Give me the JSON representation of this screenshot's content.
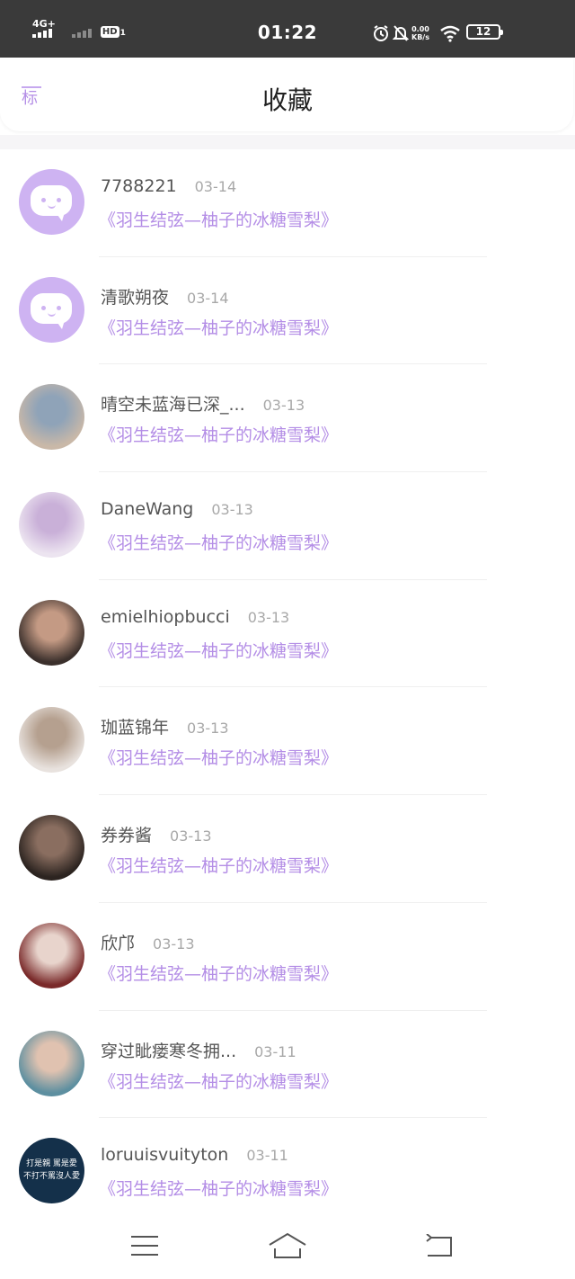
{
  "status_bar": {
    "network": "4G+",
    "hd_label": "HD",
    "hd_sub": "1",
    "time": "01:22",
    "speed_value": "0.00",
    "speed_unit": "KB/s",
    "battery": "12"
  },
  "header": {
    "back_label": "标",
    "title": "收藏"
  },
  "favorites": [
    {
      "name": "7788221",
      "date": "03-14",
      "ref": "《羽生结弦—柚子的冰糖雪梨》",
      "avatar": "default"
    },
    {
      "name": "清歌朔夜",
      "date": "03-14",
      "ref": "《羽生结弦—柚子的冰糖雪梨》",
      "avatar": "default"
    },
    {
      "name": "晴空未蓝海已深_...",
      "date": "03-13",
      "ref": "《羽生结弦—柚子的冰糖雪梨》",
      "avatar": "photo",
      "avatar_color": "#c9b8a8",
      "avatar_color2": "#8fa3b8"
    },
    {
      "name": "DaneWang",
      "date": "03-13",
      "ref": "《羽生结弦—柚子的冰糖雪梨》",
      "avatar": "photo",
      "avatar_color": "#ece4f0",
      "avatar_color2": "#c9b0d8"
    },
    {
      "name": "emielhiopbucci",
      "date": "03-13",
      "ref": "《羽生结弦—柚子的冰糖雪梨》",
      "avatar": "photo",
      "avatar_color": "#3b302c",
      "avatar_color2": "#c49a84"
    },
    {
      "name": "珈蓝锦年",
      "date": "03-13",
      "ref": "《羽生结弦—柚子的冰糖雪梨》",
      "avatar": "photo",
      "avatar_color": "#e8e2de",
      "avatar_color2": "#b5a08f"
    },
    {
      "name": "券券酱",
      "date": "03-13",
      "ref": "《羽生结弦—柚子的冰糖雪梨》",
      "avatar": "photo",
      "avatar_color": "#2c2420",
      "avatar_color2": "#8a6e60"
    },
    {
      "name": "欣邝",
      "date": "03-13",
      "ref": "《羽生结弦—柚子的冰糖雪梨》",
      "avatar": "photo",
      "avatar_color": "#7a2a2a",
      "avatar_color2": "#e8d4cc"
    },
    {
      "name": "穿过眦瘘寒冬拥...",
      "date": "03-11",
      "ref": "《羽生结弦—柚子的冰糖雪梨》",
      "avatar": "photo",
      "avatar_color": "#5d8fa0",
      "avatar_color2": "#e0c2b0"
    },
    {
      "name": "loruuisvuityton",
      "date": "03-11",
      "ref": "《羽生结弦—柚子的冰糖雪梨》",
      "avatar": "text",
      "avatar_text": "打是親 罵是愛 不打不罵沒人愛",
      "avatar_color": "#14304a",
      "avatar_color2": "#14304a"
    }
  ],
  "colors": {
    "accent": "#b48ee6",
    "avatar_default": "#ceb3f2"
  },
  "navbar": {
    "icons": [
      "menu-icon",
      "home-icon",
      "back-icon"
    ]
  }
}
